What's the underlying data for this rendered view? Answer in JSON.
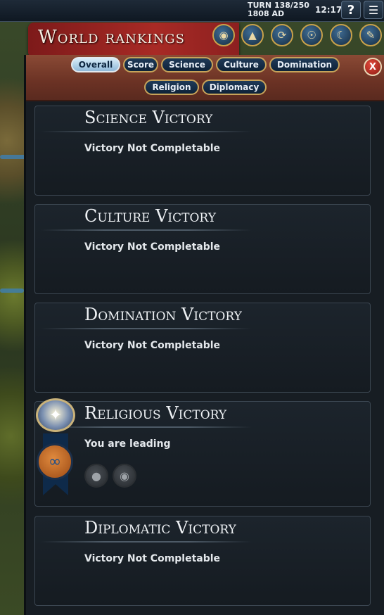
{
  "topbar": {
    "turn": "TURN 138/250",
    "year": "1808 AD",
    "clock": "12:17",
    "help_label": "?",
    "menu_icon": "hamburger-menu-icon"
  },
  "header": {
    "title": "World rankings",
    "icons": [
      "world-congress-icon",
      "city-states-icon",
      "great-works-icon",
      "spy-icon",
      "religion-icon",
      "victory-icon"
    ]
  },
  "tabs": {
    "row1": [
      "Overall",
      "Score",
      "Science",
      "Culture",
      "Domination"
    ],
    "row2": [
      "Religion",
      "Diplomacy"
    ],
    "active": "Overall",
    "close_label": "X"
  },
  "victories": [
    {
      "title": "Science Victory",
      "status": "Victory Not Completable"
    },
    {
      "title": "Culture Victory",
      "status": "Victory Not Completable"
    },
    {
      "title": "Domination Victory",
      "status": "Victory Not Completable"
    },
    {
      "title": "Religious Victory",
      "status": "You are leading",
      "civ_icons": [
        "mask-civ-icon",
        "bull-civ-icon"
      ]
    },
    {
      "title": "Diplomatic Victory",
      "status": "Victory Not Completable"
    }
  ],
  "colors": {
    "accent_gold": "#c7a35a",
    "banner_red": "#a82a25",
    "tab_blue": "#1f3a58"
  }
}
